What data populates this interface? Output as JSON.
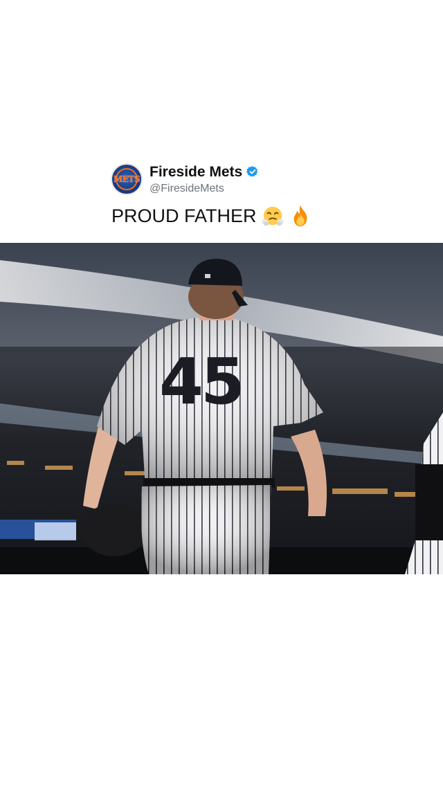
{
  "tweet": {
    "display_name": "Fireside Mets",
    "handle": "@FiresideMets",
    "verified": true,
    "text": "PROUD FATHER",
    "emojis": [
      "face-with-steam-from-nose-icon",
      "fire-icon"
    ],
    "avatar_logo_text": "METS"
  },
  "photo": {
    "jersey_number": "45"
  },
  "colors": {
    "verified_blue": "#1d9bf0",
    "text": "#111111",
    "handle_gray": "#6e7378",
    "avatar_blue": "#1b3f86",
    "avatar_orange": "#f26b21"
  }
}
